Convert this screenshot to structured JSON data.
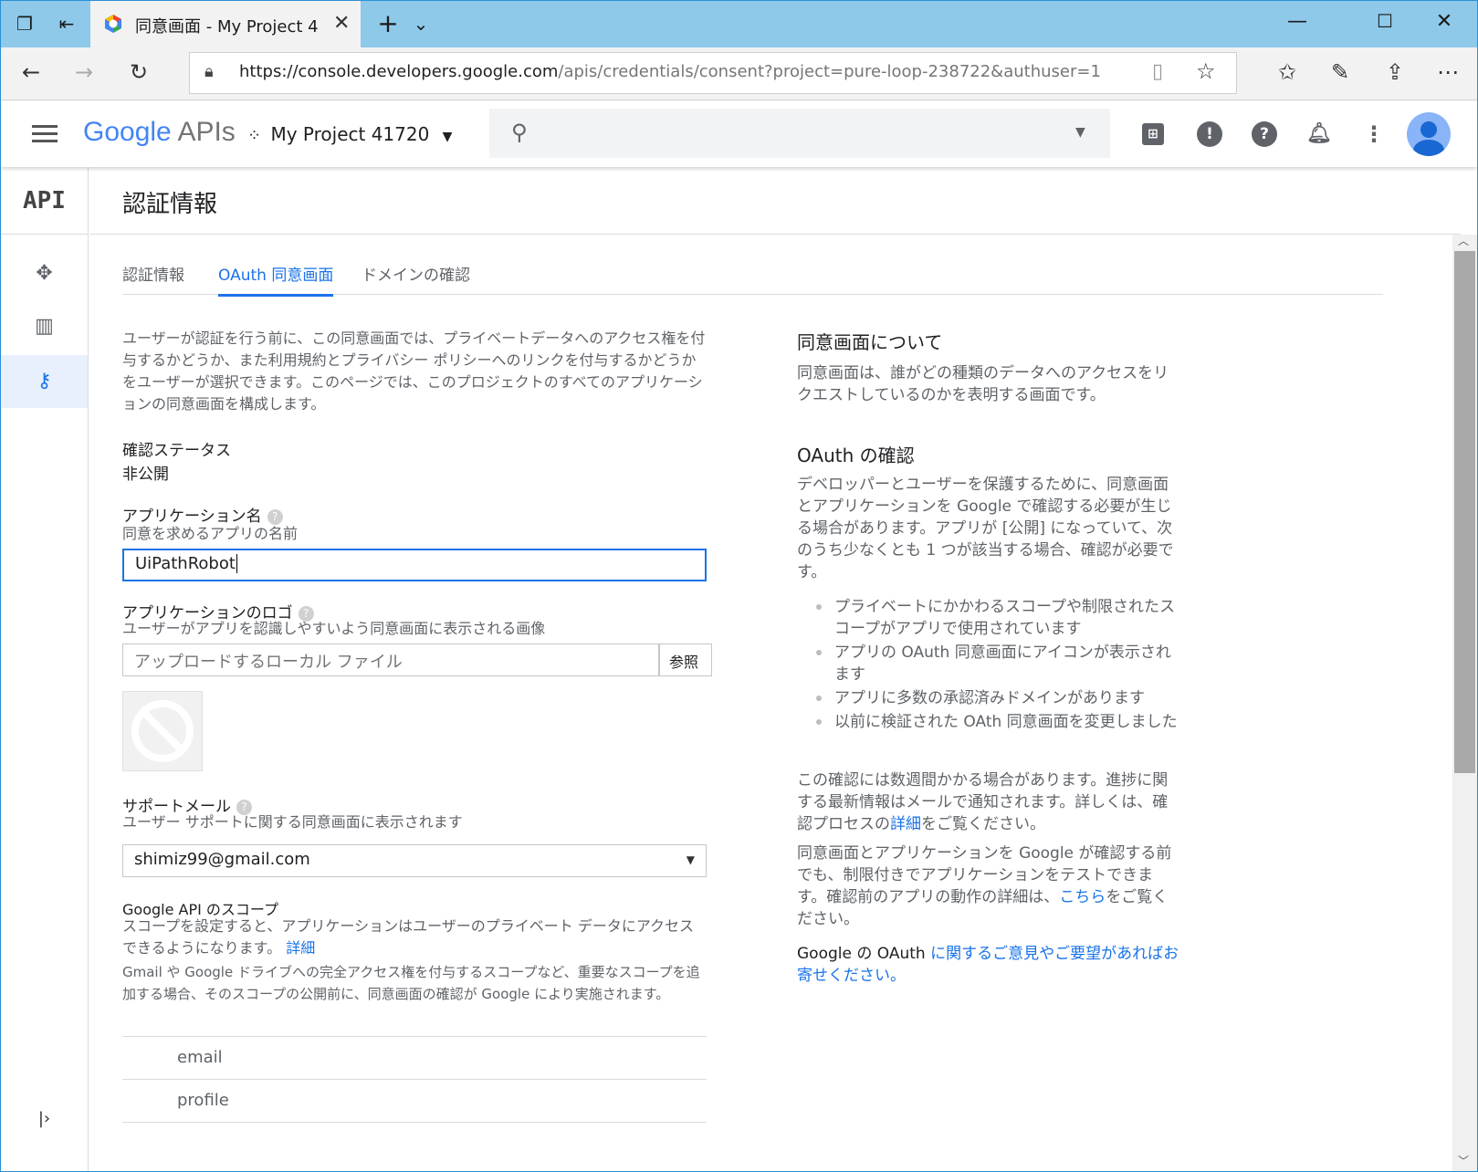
{
  "browser": {
    "tab_title": "同意画面 - My Project 4",
    "url_host": "https://console.developers.google.com",
    "url_rest": "/apis/credentials/consent?project=pure-loop-238722&authuser=1"
  },
  "header": {
    "logo_google": "Google",
    "logo_apis": "APIs",
    "project_name": "My Project 41720"
  },
  "leftnav": {
    "api_label": "API"
  },
  "page": {
    "title": "認証情報",
    "tabs": [
      "認証情報",
      "OAuth 同意画面",
      "ドメインの確認"
    ],
    "active_tab": 1
  },
  "form": {
    "intro": "ユーザーが認証を行う前に、この同意画面では、プライベートデータへのアクセス権を付与するかどうか、また利用規約とプライバシー ポリシーへのリンクを付与するかどうかをユーザーが選択できます。このページでは、このプロジェクトのすべてのアプリケーションの同意画面を構成します。",
    "status_label": "確認ステータス",
    "status_value": "非公開",
    "app_name_label": "アプリケーション名",
    "app_name_help": "同意を求めるアプリの名前",
    "app_name_value": "UiPathRobot",
    "logo_label": "アプリケーションのロゴ",
    "logo_help": "ユーザーがアプリを認識しやすいよう同意画面に表示される画像",
    "logo_placeholder": "アップロードするローカル ファイル",
    "browse_label": "参照",
    "support_label": "サポートメール",
    "support_help": "ユーザー サポートに関する同意画面に表示されます",
    "support_value": "shimiz99@gmail.com",
    "scopes_label": "Google API のスコープ",
    "scopes_help": "スコープを設定すると、アプリケーションはユーザーのプライベート データにアクセスできるようになります。",
    "scopes_link": "詳細",
    "scopes_note": "Gmail や Google ドライブへの完全アクセス権を付与するスコープなど、重要なスコープを追加する場合、そのスコープの公開前に、同意画面の確認が Google により実施されます。",
    "scopes": [
      "email",
      "profile"
    ]
  },
  "aside": {
    "about_title": "同意画面について",
    "about_text": "同意画面は、誰がどの種類のデータへのアクセスをリクエストしているのかを表明する画面です。",
    "verify_title": "OAuth の確認",
    "verify_text": "デベロッパーとユーザーを保護するために、同意画面とアプリケーションを Google で確認する必要が生じる場合があります。アプリが [公開] になっていて、次のうち少なくとも 1 つが該当する場合、確認が必要です。",
    "bullets": [
      "プライベートにかかわるスコープや制限されたスコープがアプリで使用されています",
      "アプリの OAuth 同意画面にアイコンが表示されます",
      "アプリに多数の承認済みドメインがあります",
      "以前に検証された OAth 同意画面を変更しました"
    ],
    "weeks_text_a": "この確認には数週間かかる場合があります。進捗に関する最新情報はメールで通知されます。詳しくは、確認プロセスの",
    "weeks_link": "詳細",
    "weeks_text_b": "をご覧ください。",
    "test_text_a": "同意画面とアプリケーションを Google が確認する前でも、制限付きでアプリケーションをテストできます。確認前のアプリの動作の詳細は、",
    "test_link": "こちら",
    "test_text_b": "をご覧ください。",
    "feedback_a": "Google の OAuth ",
    "feedback_link": "に関するご意見やご要望があればお寄せください。"
  }
}
